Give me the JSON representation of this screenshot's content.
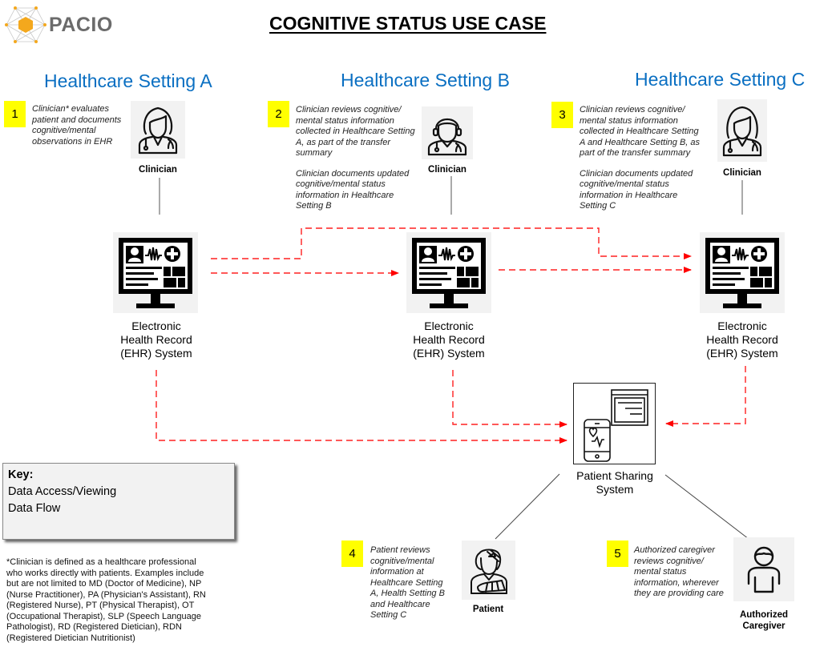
{
  "header": {
    "logo_text": "PACIO",
    "title": "COGNITIVE STATUS USE CASE"
  },
  "settings": [
    {
      "title": "Healthcare Setting A"
    },
    {
      "title": "Healthcare Setting B"
    },
    {
      "title": "Healthcare Setting C"
    }
  ],
  "steps": [
    {
      "number": "1",
      "lines": [
        "Clinician* evaluates",
        "patient and documents",
        "cognitive/mental",
        "observations in EHR"
      ]
    },
    {
      "number": "2",
      "lines": [
        "Clinician reviews cognitive/",
        "mental status information",
        "collected in Healthcare Setting",
        "A, as part of the transfer",
        "summary"
      ],
      "lines2": [
        "Clinician documents updated",
        "cognitive/mental status",
        "information in Healthcare",
        "Setting B"
      ]
    },
    {
      "number": "3",
      "lines": [
        "Clinician reviews cognitive/",
        "mental status information",
        "collected in Healthcare Setting",
        "A and Healthcare Setting B, as",
        "part of the transfer summary"
      ],
      "lines2": [
        "Clinician documents updated",
        "cognitive/mental status",
        "information in Healthcare",
        "Setting C"
      ]
    },
    {
      "number": "4",
      "lines": [
        "Patient reviews",
        "cognitive/mental",
        "information at",
        "Healthcare Setting",
        "A, Health Setting B",
        "and Healthcare",
        "Setting C"
      ]
    },
    {
      "number": "5",
      "lines": [
        "Authorized caregiver",
        "reviews cognitive/",
        "mental status",
        "information, wherever",
        "they are providing care"
      ]
    }
  ],
  "roles": {
    "clinician_a": "Clinician",
    "clinician_b": "Clinician",
    "clinician_c": "Clinician",
    "patient": "Patient",
    "caregiver_line1": "Authorized",
    "caregiver_line2": "Caregiver"
  },
  "systems": {
    "ehr": [
      "Electronic",
      "Health Record",
      "(EHR) System"
    ],
    "sharing": [
      "Patient Sharing",
      "System"
    ]
  },
  "key": {
    "title": "Key:",
    "access_label": "Data Access/Viewing",
    "flow_label": "Data Flow"
  },
  "footnote": [
    "*Clinician is defined as a healthcare professional",
    "who works directly with patients. Examples include",
    "but are not limited to MD (Doctor of Medicine), NP",
    "(Nurse Practitioner), PA (Physician's Assistant), RN",
    "(Registered Nurse), PT (Physical Therapist), OT",
    "(Occupational Therapist), SLP (Speech Language",
    "Pathologist), RD (Registered Dietician), RDN",
    "(Registered Dietician Nutritionist)"
  ],
  "colors": {
    "setting_title": "#0a6fc2",
    "step_badge": "#ffff00",
    "data_flow": "#ff0000",
    "logo_accent": "#f4a81d"
  }
}
